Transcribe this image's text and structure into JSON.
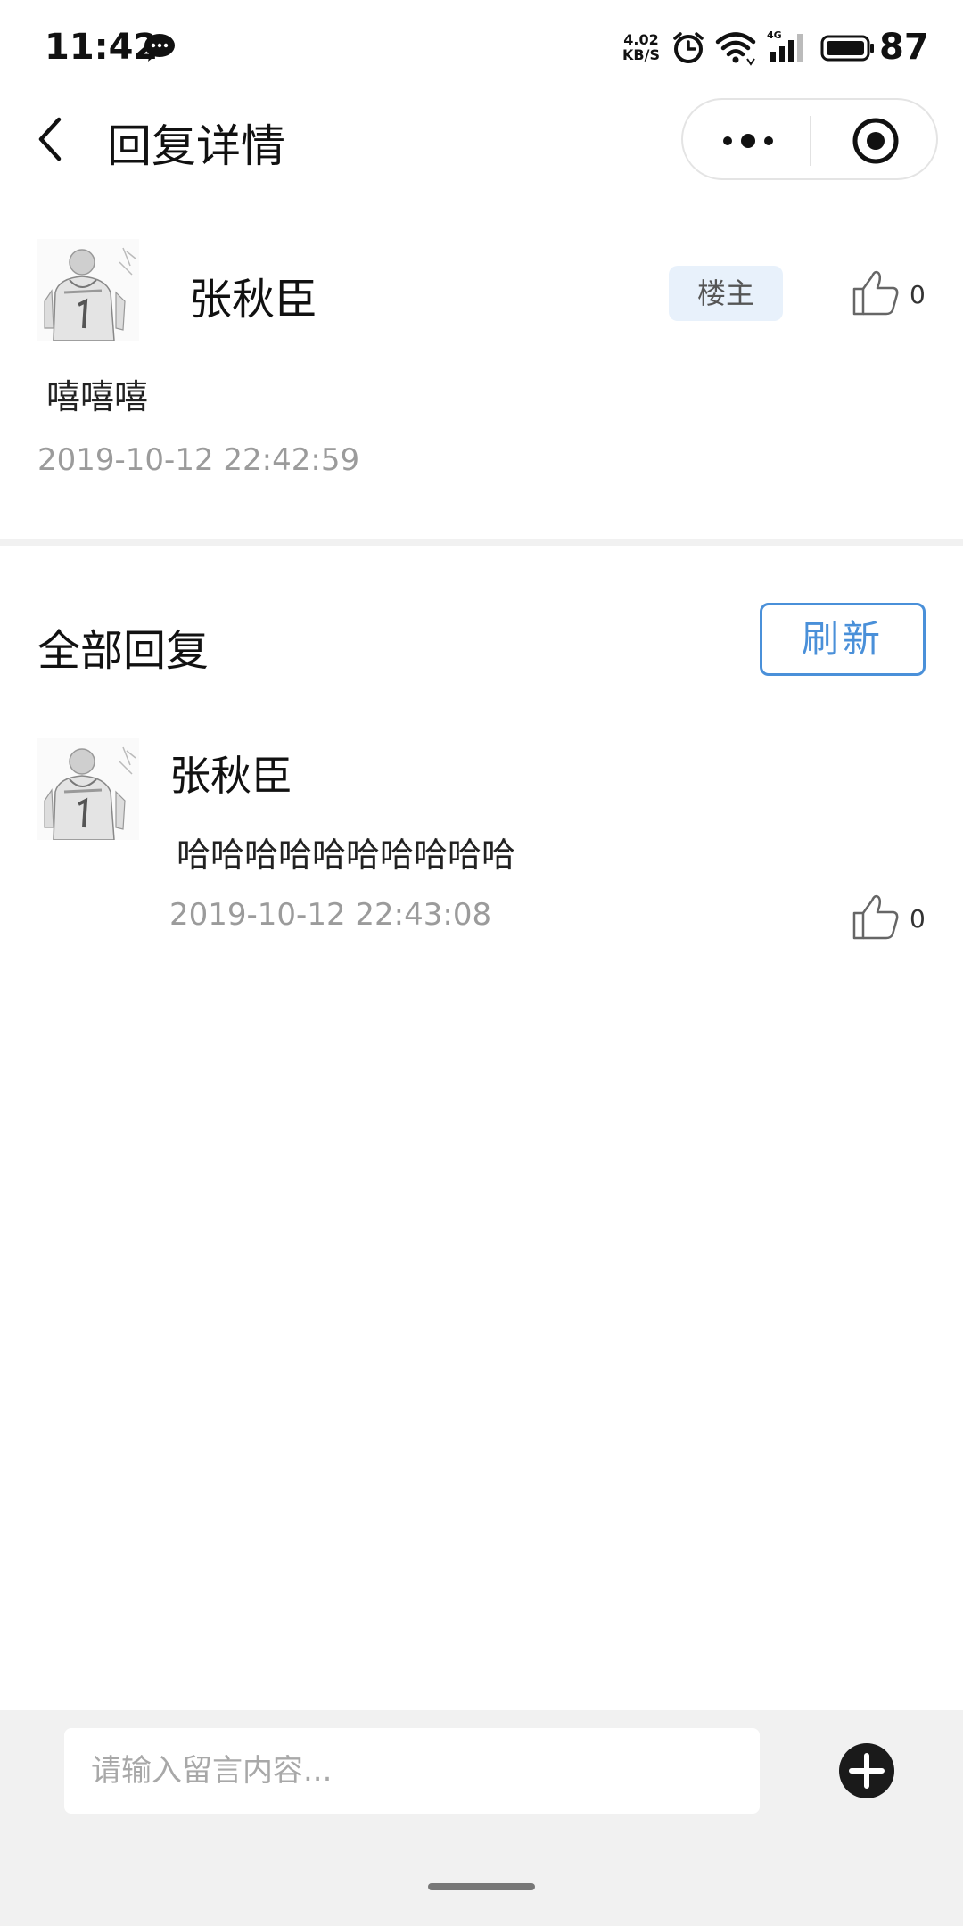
{
  "status_bar": {
    "time": "11:42",
    "speed_value": "4.02",
    "speed_unit": "KB/S",
    "battery": "87",
    "icons": [
      "chat-bubble-icon",
      "alarm-icon",
      "wifi-icon",
      "4g-signal-icon",
      "battery-icon"
    ]
  },
  "nav": {
    "title": "回复详情",
    "icons": [
      "back-icon",
      "more-icon",
      "close-target-icon"
    ]
  },
  "main_post": {
    "author": "张秋臣",
    "badge": "楼主",
    "likes": "0",
    "content": "嘻嘻嘻",
    "time": "2019-10-12 22:42:59"
  },
  "replies_section": {
    "title": "全部回复",
    "refresh_label": "刷新",
    "items": [
      {
        "author": "张秋臣",
        "content": "哈哈哈哈哈哈哈哈哈哈",
        "time": "2019-10-12 22:43:08",
        "likes": "0"
      }
    ]
  },
  "composer": {
    "placeholder": "请输入留言内容...",
    "value": "",
    "add_icon": "plus-circle-icon"
  },
  "colors": {
    "accent": "#4a90d9",
    "badge_bg": "#e8f1fb",
    "muted_text": "#9b9b9b",
    "bottom_bar": "#f1f1f1"
  }
}
